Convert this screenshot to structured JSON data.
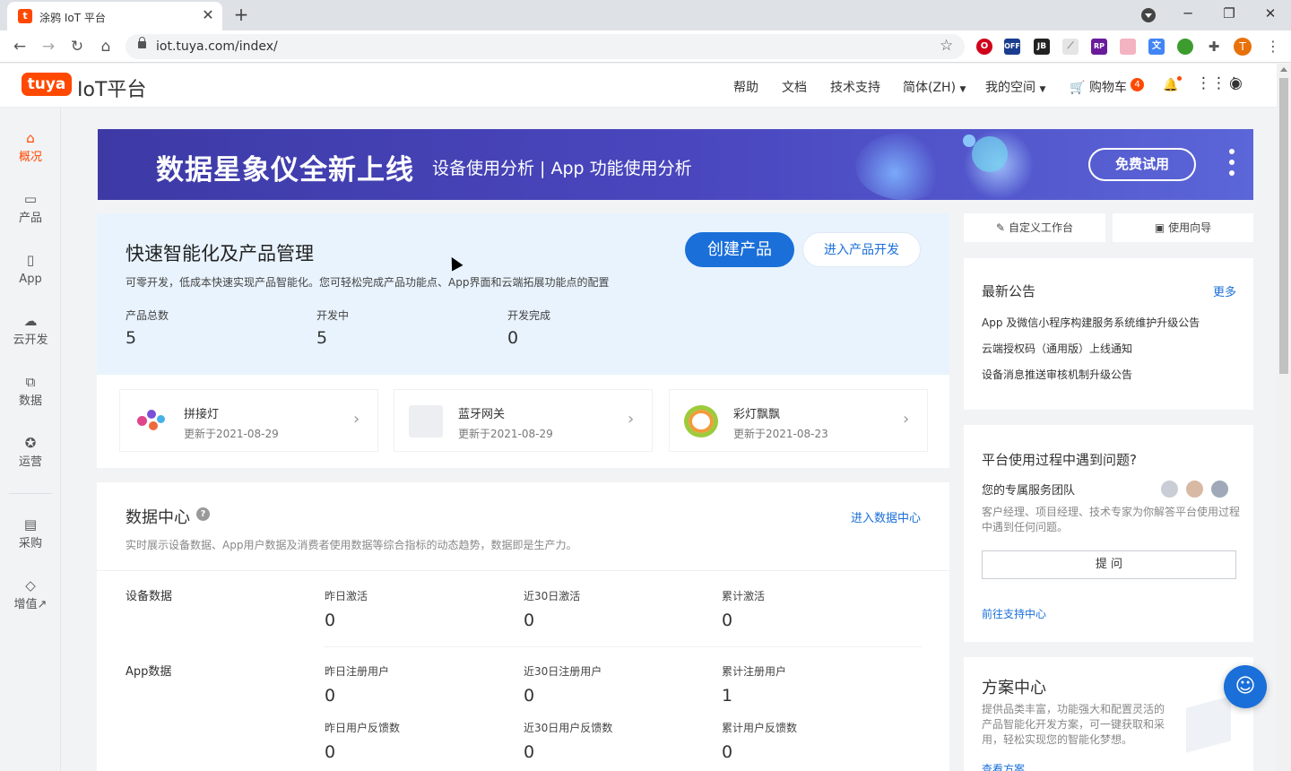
{
  "browser": {
    "tab_title": "涂鸦 IoT 平台",
    "favicon_letter": "t",
    "url": "iot.tuya.com/index/",
    "profile_letter": "T"
  },
  "header": {
    "logo_badge": "tuya",
    "logo_text": "IoT平台",
    "nav": {
      "help": "帮助",
      "docs": "文档",
      "support": "技术支持",
      "language": "简体(ZH)",
      "space": "我的空间",
      "cart": "购物车",
      "cart_count": "4"
    }
  },
  "sidebar": {
    "items": [
      {
        "label": "概况",
        "icon": "home-icon",
        "active": true
      },
      {
        "label": "产品",
        "icon": "product-icon"
      },
      {
        "label": "App",
        "icon": "phone-icon"
      },
      {
        "label": "云开发",
        "icon": "cloud-icon"
      },
      {
        "label": "数据",
        "icon": "chart-icon"
      },
      {
        "label": "运营",
        "icon": "operations-icon"
      },
      {
        "label": "采购",
        "icon": "purchase-icon"
      },
      {
        "label": "增值↗",
        "icon": "diamond-icon"
      }
    ]
  },
  "banner": {
    "title": "数据星象仪全新上线",
    "subtitle": "设备使用分析 | App 功能使用分析",
    "button": "免费试用"
  },
  "product_section": {
    "title": "快速智能化及产品管理",
    "description": "可零开发，低成本快速实现产品智能化。您可轻松完成产品功能点、App界面和云端拓展功能点的配置",
    "create_button": "创建产品",
    "enter_dev_button": "进入产品开发",
    "stats": [
      {
        "label": "产品总数",
        "value": "5"
      },
      {
        "label": "开发中",
        "value": "5"
      },
      {
        "label": "开发完成",
        "value": "0"
      }
    ],
    "products": [
      {
        "name": "拼接灯",
        "updated": "更新于2021-08-29"
      },
      {
        "name": "蓝牙网关",
        "updated": "更新于2021-08-29"
      },
      {
        "name": "彩灯飘飘",
        "updated": "更新于2021-08-23"
      }
    ]
  },
  "data_center": {
    "title": "数据中心",
    "enter_link": "进入数据中心",
    "description": "实时展示设备数据、App用户数据及消费者使用数据等综合指标的动态趋势，数据即是生产力。",
    "device": {
      "label": "设备数据",
      "metrics": [
        {
          "label": "昨日激活",
          "value": "0"
        },
        {
          "label": "近30日激活",
          "value": "0"
        },
        {
          "label": "累计激活",
          "value": "0"
        }
      ]
    },
    "app": {
      "label": "App数据",
      "metrics": [
        {
          "label": "昨日注册用户",
          "value": "0"
        },
        {
          "label": "近30日注册用户",
          "value": "0"
        },
        {
          "label": "累计注册用户",
          "value": "1"
        },
        {
          "label": "昨日用户反馈数",
          "value": "0"
        },
        {
          "label": "近30日用户反馈数",
          "value": "0"
        },
        {
          "label": "累计用户反馈数",
          "value": "0"
        }
      ]
    }
  },
  "right_panel": {
    "workbench": "自定义工作台",
    "guide": "使用向导",
    "announcements": {
      "title": "最新公告",
      "more": "更多",
      "items": [
        "App 及微信小程序构建服务系统维护升级公告",
        "云端授权码（通用版）上线通知",
        "设备消息推送审核机制升级公告"
      ]
    },
    "support": {
      "title": "平台使用过程中遇到问题?",
      "team": "您的专属服务团队",
      "description": "客户经理、项目经理、技术专家为你解答平台使用过程中遇到任何问题。",
      "ask_button": "提 问",
      "link": "前往支持中心"
    },
    "solutions": {
      "title": "方案中心",
      "description": "提供品类丰富，功能强大和配置灵活的产品智能化开发方案，可一键获取和采用，轻松实现您的智能化梦想。",
      "link": "查看方案"
    }
  }
}
